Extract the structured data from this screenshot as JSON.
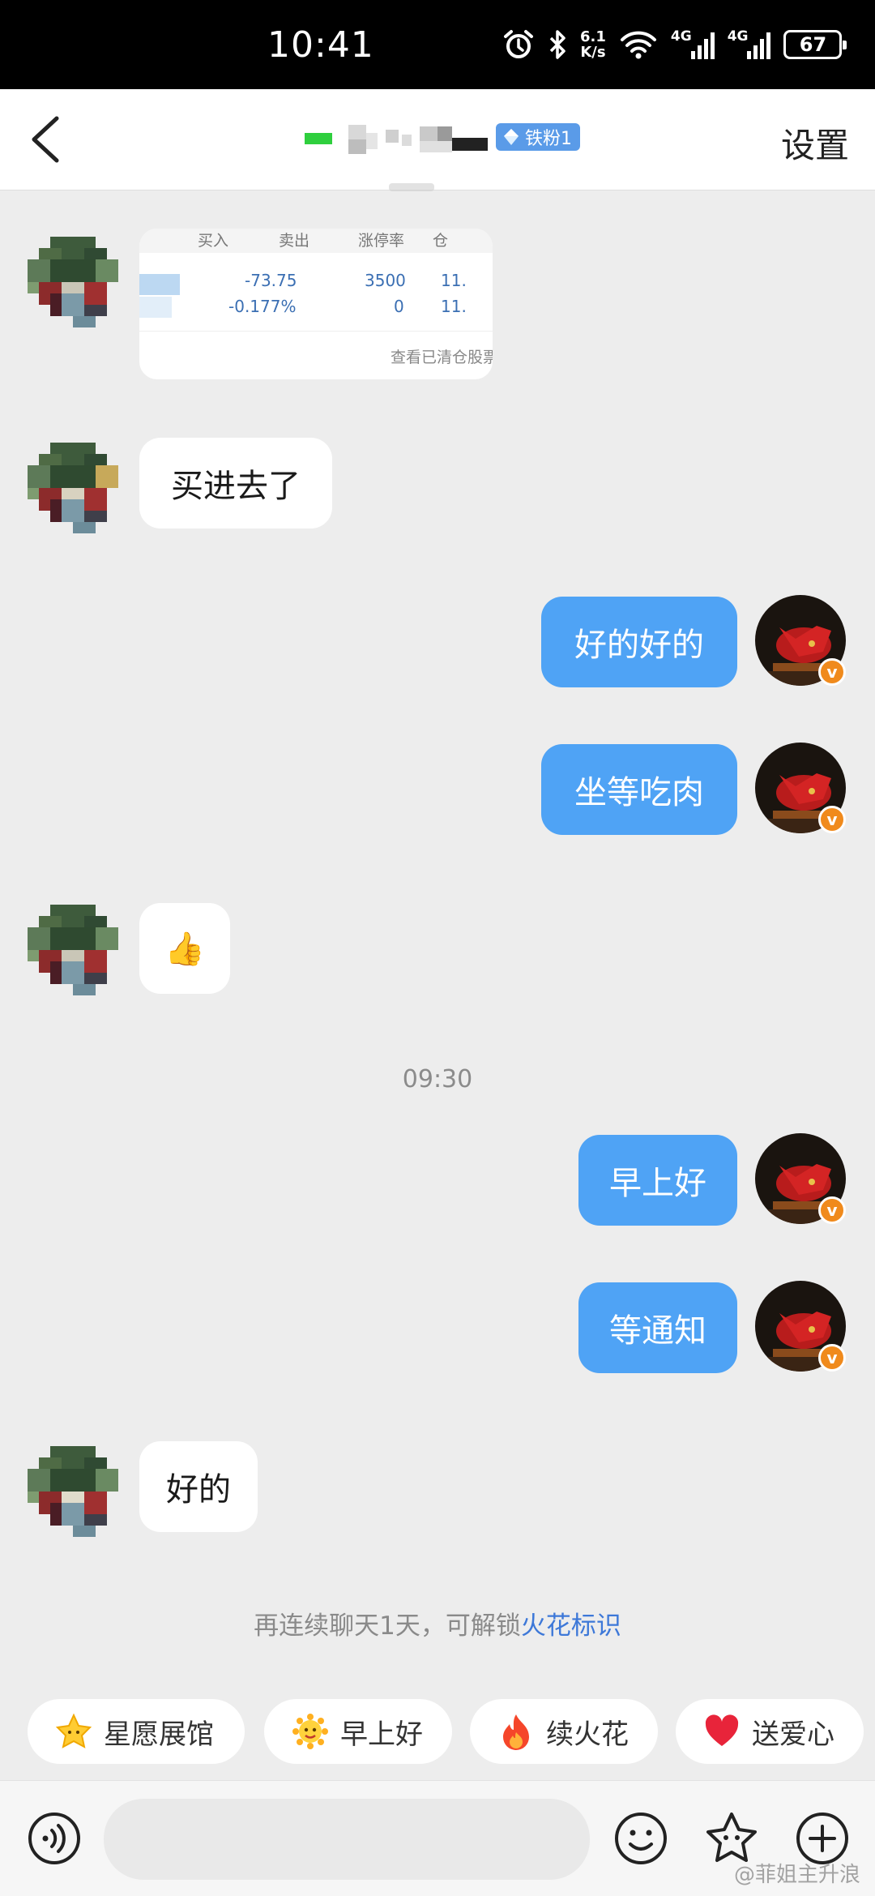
{
  "status_bar": {
    "time": "10:41",
    "net_speed_value": "6.1",
    "net_speed_unit": "K/s",
    "net_label_1": "4G",
    "net_label_2": "4G",
    "battery": "67"
  },
  "header": {
    "back_icon": "chevron-left-icon",
    "fan_badge": "铁粉1",
    "settings_label": "设置"
  },
  "shared_card": {
    "col_headers": [
      "买入",
      "卖出",
      "涨停率",
      "仓"
    ],
    "row1": [
      "-73.75",
      "3500",
      "11."
    ],
    "row2": [
      "-0.177%",
      "0",
      "11."
    ],
    "footer_link": "查看已清仓股票"
  },
  "messages": [
    {
      "side": "in",
      "text": "买进去了"
    },
    {
      "side": "out",
      "text": "好的好的"
    },
    {
      "side": "out",
      "text": "坐等吃肉"
    },
    {
      "side": "in",
      "emoji": "👍"
    },
    {
      "side": "out",
      "text": "早上好"
    },
    {
      "side": "out",
      "text": "等通知"
    },
    {
      "side": "in",
      "text": "好的"
    }
  ],
  "time_separator": "09:30",
  "streak_hint": {
    "prefix": "再连续聊天1天，可解锁",
    "highlight": "火花标识"
  },
  "quick_chips": [
    {
      "label": "星愿展馆",
      "icon": "star-face-icon"
    },
    {
      "label": "早上好",
      "icon": "sun-face-icon"
    },
    {
      "label": "续火花",
      "icon": "flame-icon"
    },
    {
      "label": "送爱心",
      "icon": "heart-icon"
    }
  ],
  "input_bar": {
    "voice_icon": "voice-icon",
    "emoji_icon": "smiley-icon",
    "sticker_icon": "star-sticker-icon",
    "more_icon": "plus-circle-icon"
  },
  "watermark": "@菲姐主升浪",
  "colors": {
    "outgoing_bubble": "#4fa3f5",
    "background": "#ededed",
    "highlight_link": "#3d78d8",
    "fan_badge": "#5a9be8"
  }
}
